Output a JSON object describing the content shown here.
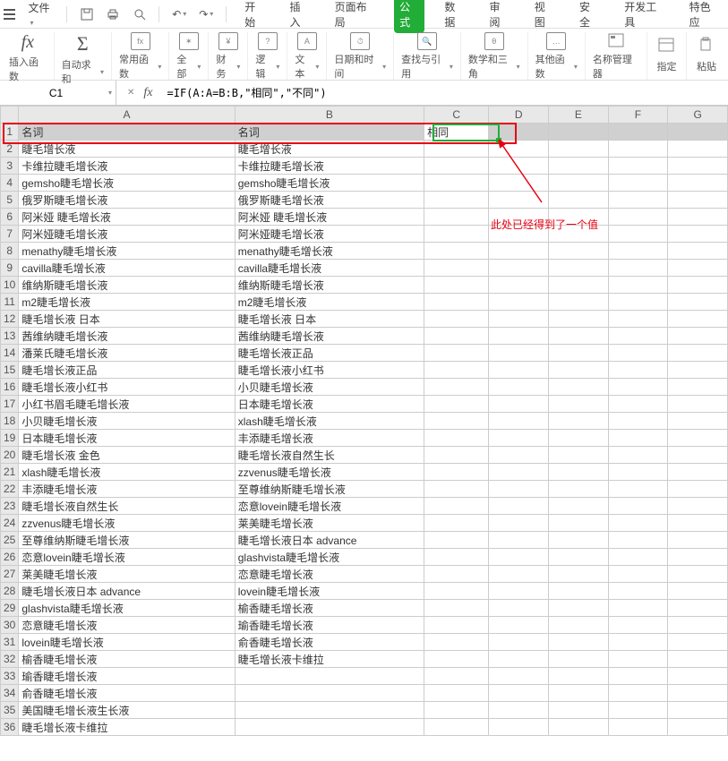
{
  "menubar": {
    "file_label": "文件",
    "tabs": [
      "开始",
      "插入",
      "页面布局",
      "公式",
      "数据",
      "审阅",
      "视图",
      "安全",
      "开发工具",
      "特色应"
    ],
    "active_tab_index": 3
  },
  "ribbon": {
    "groups": [
      {
        "label": "插入函数",
        "has_caret": false
      },
      {
        "label": "自动求和",
        "has_caret": true
      },
      {
        "label": "常用函数",
        "has_caret": true
      },
      {
        "label": "全部",
        "has_caret": true
      },
      {
        "label": "财务",
        "has_caret": true
      },
      {
        "label": "逻辑",
        "has_caret": true
      },
      {
        "label": "文本",
        "has_caret": true
      },
      {
        "label": "日期和时间",
        "has_caret": true
      },
      {
        "label": "查找与引用",
        "has_caret": true
      },
      {
        "label": "数学和三角",
        "has_caret": true
      },
      {
        "label": "其他函数",
        "has_caret": true
      },
      {
        "label": "名称管理器",
        "has_caret": false
      },
      {
        "label": "指定",
        "has_caret": false
      },
      {
        "label": "粘贴",
        "has_caret": false
      }
    ]
  },
  "formula_bar": {
    "name_box": "C1",
    "formula": "=IF(A:A=B:B,\"相同\",\"不同\")"
  },
  "columns": [
    "A",
    "B",
    "C",
    "D",
    "E",
    "F",
    "G"
  ],
  "annotation_text": "此处已经得到了一个值",
  "rows": [
    {
      "n": 1,
      "a": "名词",
      "b": "名词",
      "c": "相同"
    },
    {
      "n": 2,
      "a": "睫毛增长液",
      "b": "睫毛增长液",
      "c": ""
    },
    {
      "n": 3,
      "a": "卡维拉睫毛增长液",
      "b": "卡维拉睫毛增长液",
      "c": ""
    },
    {
      "n": 4,
      "a": "gemsho睫毛增长液",
      "b": "gemsho睫毛增长液",
      "c": ""
    },
    {
      "n": 5,
      "a": "俄罗斯睫毛增长液",
      "b": "俄罗斯睫毛增长液",
      "c": ""
    },
    {
      "n": 6,
      "a": "阿米娅 睫毛增长液",
      "b": "阿米娅 睫毛增长液",
      "c": ""
    },
    {
      "n": 7,
      "a": "阿米娅睫毛增长液",
      "b": "阿米娅睫毛增长液",
      "c": ""
    },
    {
      "n": 8,
      "a": "menathy睫毛增长液",
      "b": "menathy睫毛增长液",
      "c": ""
    },
    {
      "n": 9,
      "a": "cavilla睫毛增长液",
      "b": "cavilla睫毛增长液",
      "c": ""
    },
    {
      "n": 10,
      "a": "维纳斯睫毛增长液",
      "b": "维纳斯睫毛增长液",
      "c": ""
    },
    {
      "n": 11,
      "a": "m2睫毛增长液",
      "b": "m2睫毛增长液",
      "c": ""
    },
    {
      "n": 12,
      "a": "睫毛增长液 日本",
      "b": "睫毛增长液 日本",
      "c": ""
    },
    {
      "n": 13,
      "a": "茜维纳睫毛增长液",
      "b": "茜维纳睫毛增长液",
      "c": ""
    },
    {
      "n": 14,
      "a": "潘莱氏睫毛增长液",
      "b": "睫毛增长液正品",
      "c": ""
    },
    {
      "n": 15,
      "a": "睫毛增长液正品",
      "b": "睫毛增长液小红书",
      "c": ""
    },
    {
      "n": 16,
      "a": "睫毛增长液小红书",
      "b": "小贝睫毛增长液",
      "c": ""
    },
    {
      "n": 17,
      "a": "小红书眉毛睫毛增长液",
      "b": "日本睫毛增长液",
      "c": ""
    },
    {
      "n": 18,
      "a": "小贝睫毛增长液",
      "b": "xlash睫毛增长液",
      "c": ""
    },
    {
      "n": 19,
      "a": "日本睫毛增长液",
      "b": "丰添睫毛增长液",
      "c": ""
    },
    {
      "n": 20,
      "a": "睫毛增长液 金色",
      "b": "睫毛增长液自然生长",
      "c": ""
    },
    {
      "n": 21,
      "a": "xlash睫毛增长液",
      "b": "zzvenus睫毛增长液",
      "c": ""
    },
    {
      "n": 22,
      "a": "丰添睫毛增长液",
      "b": "至尊维纳斯睫毛增长液",
      "c": ""
    },
    {
      "n": 23,
      "a": "睫毛增长液自然生长",
      "b": "恋意lovein睫毛增长液",
      "c": ""
    },
    {
      "n": 24,
      "a": "zzvenus睫毛增长液",
      "b": "莱美睫毛增长液",
      "c": ""
    },
    {
      "n": 25,
      "a": "至尊维纳斯睫毛增长液",
      "b": "睫毛增长液日本 advance",
      "c": ""
    },
    {
      "n": 26,
      "a": "恋意lovein睫毛增长液",
      "b": "glashvista睫毛增长液",
      "c": ""
    },
    {
      "n": 27,
      "a": "莱美睫毛增长液",
      "b": "恋意睫毛增长液",
      "c": ""
    },
    {
      "n": 28,
      "a": "睫毛增长液日本 advance",
      "b": "lovein睫毛增长液",
      "c": ""
    },
    {
      "n": 29,
      "a": "glashvista睫毛增长液",
      "b": "榆香睫毛增长液",
      "c": ""
    },
    {
      "n": 30,
      "a": "恋意睫毛增长液",
      "b": "瑜香睫毛增长液",
      "c": ""
    },
    {
      "n": 31,
      "a": "lovein睫毛增长液",
      "b": "俞香睫毛增长液",
      "c": ""
    },
    {
      "n": 32,
      "a": "榆香睫毛增长液",
      "b": "睫毛增长液卡维拉",
      "c": ""
    },
    {
      "n": 33,
      "a": "瑜香睫毛增长液",
      "b": "",
      "c": ""
    },
    {
      "n": 34,
      "a": "俞香睫毛增长液",
      "b": "",
      "c": ""
    },
    {
      "n": 35,
      "a": "美国睫毛增长液生长液",
      "b": "",
      "c": ""
    },
    {
      "n": 36,
      "a": "睫毛增长液卡维拉",
      "b": "",
      "c": ""
    }
  ]
}
